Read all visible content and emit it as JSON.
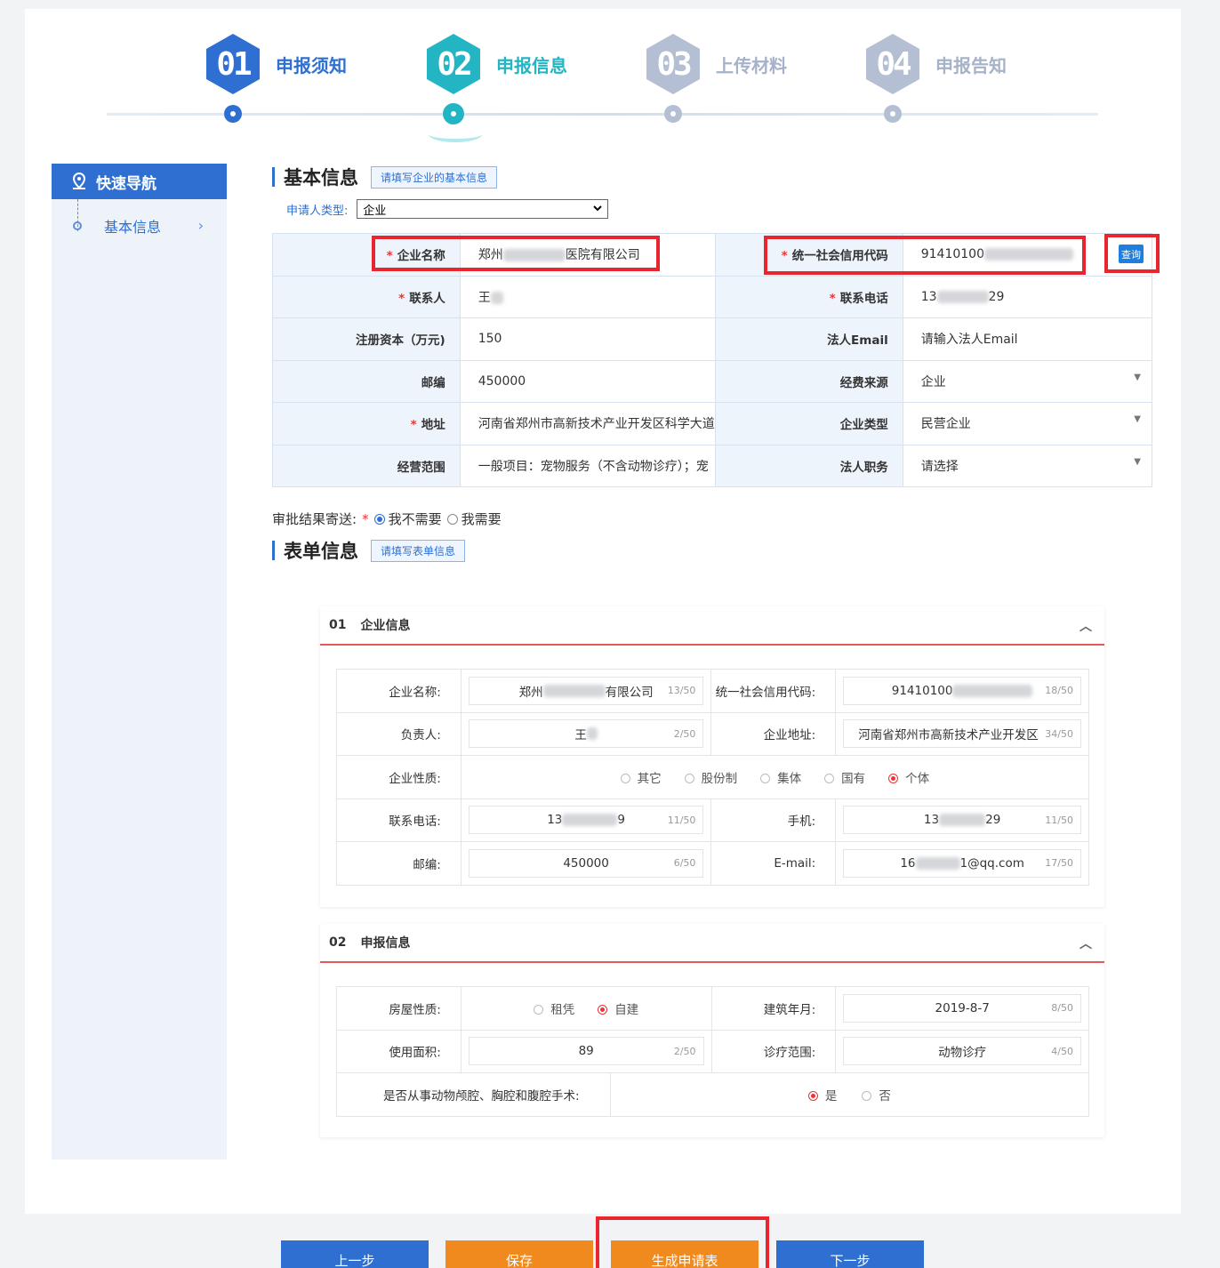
{
  "steps": [
    {
      "num": "01",
      "label": "申报须知",
      "color": "#2e6fd1",
      "labelcolor": "#2e6fd1"
    },
    {
      "num": "02",
      "label": "申报信息",
      "color": "#23b5c3",
      "labelcolor": "#23b5c3"
    },
    {
      "num": "03",
      "label": "上传材料",
      "color": "#b5bfd3",
      "labelcolor": "#a6b2c8"
    },
    {
      "num": "04",
      "label": "申报告知",
      "color": "#b5bfd3",
      "labelcolor": "#a6b2c8"
    }
  ],
  "sidebar": {
    "title": "快速导航",
    "items": [
      {
        "label": "基本信息"
      }
    ]
  },
  "basic": {
    "title": "基本信息",
    "tag": "请填写企业的基本信息",
    "applicant_label": "申请人类型:",
    "applicant_value": "企业",
    "query_label": "查询",
    "rows": [
      {
        "l1": "企业名称",
        "r1": true,
        "v1a": "郑州",
        "v1b": "医院有限公司",
        "l2": "统一社会信用代码",
        "r2": true,
        "v2a": "91410100",
        "v2b": ""
      },
      {
        "l1": "联系人",
        "r1": true,
        "v1a": "王",
        "v1b": "",
        "l2": "联系电话",
        "r2": true,
        "v2a": "13",
        "v2b": "29"
      },
      {
        "l1": "注册资本（万元)",
        "r1": false,
        "v1a": "150",
        "v1b": "",
        "l2": "法人Email",
        "r2": false,
        "ph2": "请输入法人Email"
      },
      {
        "l1": "邮编",
        "r1": false,
        "v1a": "450000",
        "v1b": "",
        "l2": "经费来源",
        "r2": false,
        "dd2": "企业"
      },
      {
        "l1": "地址",
        "r1": true,
        "v1a": "河南省郑州市高新技术产业开发区科学大道",
        "v1b": "",
        "l2": "企业类型",
        "r2": false,
        "dd2": "民营企业"
      },
      {
        "l1": "经营范围",
        "r1": false,
        "v1a": "一般项目：宠物服务（不含动物诊疗）；宠",
        "v1b": "",
        "l2": "法人职务",
        "r2": false,
        "dd2": "请选择"
      }
    ]
  },
  "mailing": {
    "label": "审批结果寄送:",
    "opt1": "我不需要",
    "opt2": "我需要"
  },
  "form": {
    "title": "表单信息",
    "tag": "请填写表单信息"
  },
  "panel1": {
    "num": "01",
    "title": "企业信息",
    "name_label": "企业名称:",
    "name_a": "郑州",
    "name_b": "有限公司",
    "name_cnt": "13/50",
    "code_label": "统一社会信用代码:",
    "code_val": "91410100",
    "code_cnt": "18/50",
    "person_label": "负责人:",
    "person_val": "王",
    "person_cnt": "2/50",
    "addr_label": "企业地址:",
    "addr_val": "河南省郑州市高新技术产业开发区",
    "addr_cnt": "34/50",
    "nature_label": "企业性质:",
    "natures": [
      "其它",
      "股份制",
      "集体",
      "国有",
      "个体"
    ],
    "tel_label": "联系电话:",
    "tel_a": "13",
    "tel_b": "9",
    "tel_cnt": "11/50",
    "mobile_label": "手机:",
    "mobile_a": "13",
    "mobile_b": "29",
    "mobile_cnt": "11/50",
    "zip_label": "邮编:",
    "zip_val": "450000",
    "zip_cnt": "6/50",
    "email_label": "E-mail:",
    "email_a": "16",
    "email_b": "1@qq.com",
    "email_cnt": "17/50"
  },
  "panel2": {
    "num": "02",
    "title": "申报信息",
    "house_label": "房屋性质:",
    "house_opt1": "租凭",
    "house_opt2": "自建",
    "build_label": "建筑年月:",
    "build_val": "2019-8-7",
    "build_cnt": "8/50",
    "area_label": "使用面积:",
    "area_val": "89",
    "area_cnt": "2/50",
    "scope_label": "诊疗范围:",
    "scope_val": "动物诊疗",
    "scope_cnt": "4/50",
    "surgery_label": "是否从事动物颅腔、胸腔和腹腔手术:",
    "yes": "是",
    "no": "否"
  },
  "buttons": {
    "prev": "上一步",
    "save": "保存",
    "generate": "生成申请表",
    "next": "下一步"
  }
}
